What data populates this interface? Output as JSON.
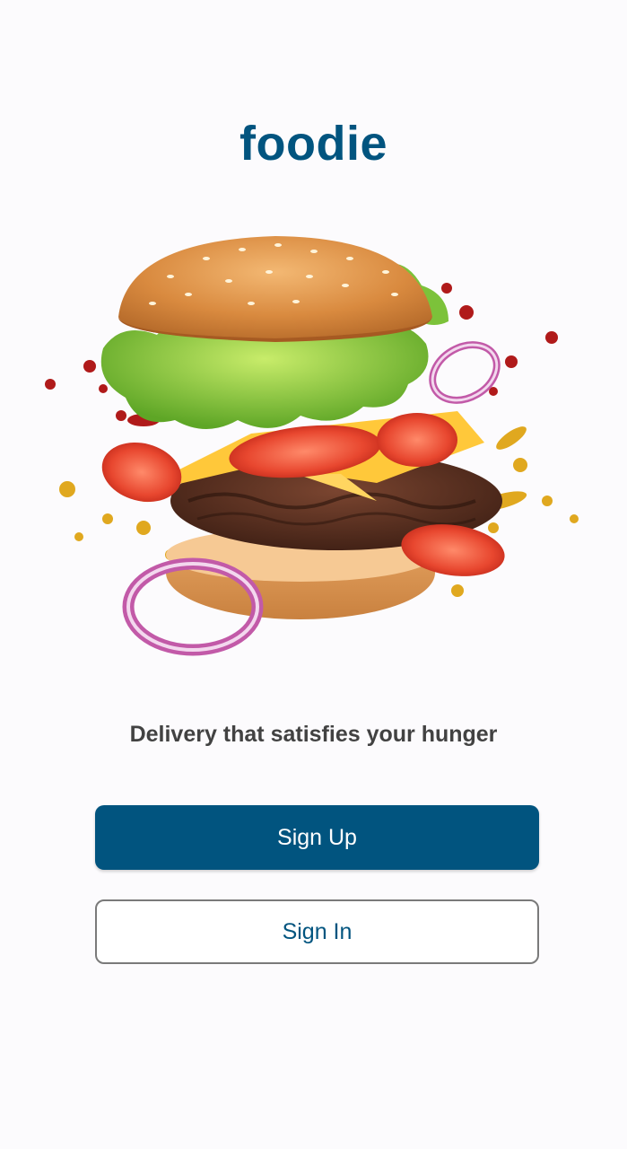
{
  "app": {
    "title": "foodie"
  },
  "hero": {
    "image": "burger-illustration"
  },
  "tagline": "Delivery that satisfies your hunger",
  "actions": {
    "sign_up_label": "Sign Up",
    "sign_in_label": "Sign In"
  },
  "colors": {
    "primary": "#01547f",
    "text": "#424242",
    "background": "#fcfbfd"
  }
}
